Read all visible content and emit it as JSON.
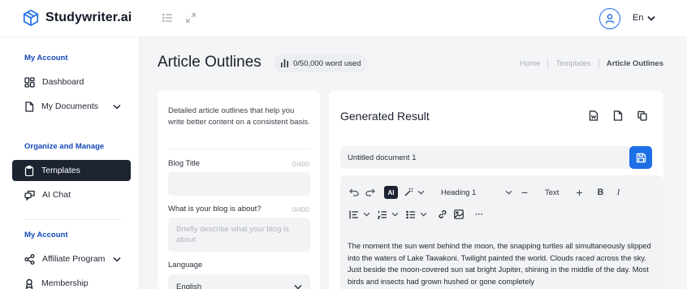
{
  "header": {
    "app_name": "Studywriter.ai",
    "language": "En",
    "icons": [
      "logo-icon",
      "menu-icon",
      "expand-icon",
      "user-icon",
      "chevron-down-icon"
    ]
  },
  "sidebar": {
    "sections": [
      {
        "title": "My Account",
        "items": [
          {
            "label": "Dashboard",
            "icon": "dashboard-icon"
          },
          {
            "label": "My Documents",
            "icon": "document-icon",
            "has_submenu": true
          }
        ]
      },
      {
        "title": "Organize and Manage",
        "items": [
          {
            "label": "Templates",
            "icon": "clipboard-icon",
            "active": true
          },
          {
            "label": "AI Chat",
            "icon": "chat-icon"
          }
        ]
      },
      {
        "title": "My Account",
        "items": [
          {
            "label": "Affiliate Program",
            "icon": "share-icon",
            "has_submenu": true
          },
          {
            "label": "Membership",
            "icon": "membership-icon"
          }
        ]
      }
    ]
  },
  "page": {
    "title": "Article Outlines",
    "usage": "0/50,000 word used",
    "breadcrumb": [
      "Home",
      "Templates",
      "Article Outlines"
    ]
  },
  "form": {
    "description": "Detailed article outlines that help you write better content on a consistent basis.",
    "blog_title": {
      "label": "Blog Title",
      "count": "0/400",
      "value": "",
      "placeholder": ""
    },
    "blog_about": {
      "label": "What is your blog is about?",
      "count": "0/400",
      "placeholder": "Briefly describe what your blog is about"
    },
    "language": {
      "label": "Language",
      "value": "English"
    }
  },
  "result": {
    "title": "Generated Result",
    "document_name": "Untitled document 1",
    "toolbar": {
      "ai_label": "AI",
      "heading_value": "Heading 1",
      "font_size_label": "Text",
      "minus": "−",
      "plus": "+",
      "bold": "B",
      "italic": "I",
      "more": "···"
    },
    "content": "The moment the sun went behind the moon, the snapping turtles all simultaneously slipped into the waters of Lake Tawakoni. Twilight painted the world. Clouds raced across the sky. Just beside the moon-covered sun sat bright Jupiter, shining in the middle of the day. Most birds and insects had grown hushed or gone completely"
  },
  "colors": {
    "accent": "#1e6fe6",
    "sidebar_active": "#1c2331",
    "section_title": "#1448b8",
    "background": "#f4f5f7"
  }
}
